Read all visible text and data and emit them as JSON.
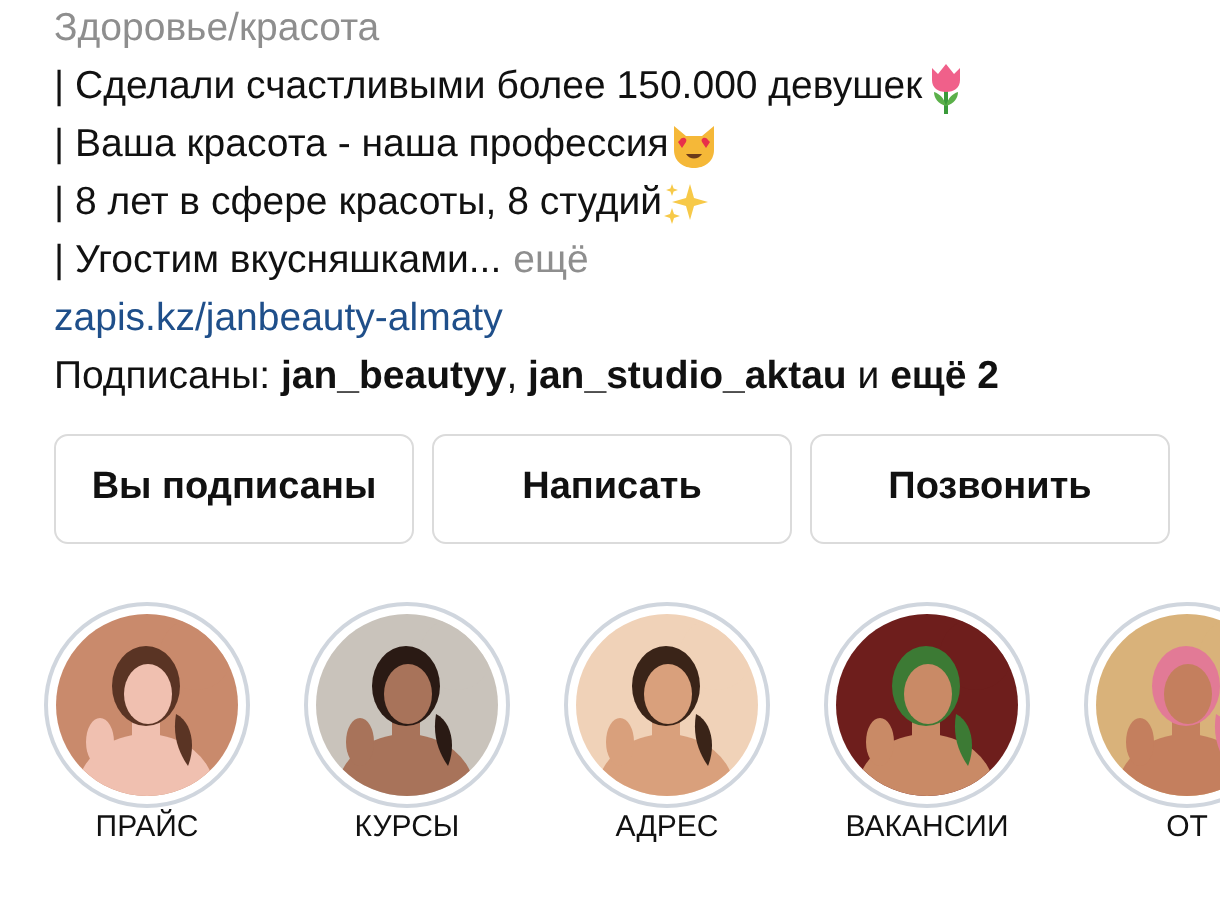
{
  "profile": {
    "category": "Здоровье/красота",
    "bio_lines": [
      {
        "text": "| Сделали счастливыми более 150.000 девушек",
        "kind": "tulip"
      },
      {
        "text": "| Ваша красота - наша профессия",
        "kind": "cat"
      },
      {
        "text": "| 8 лет в сфере красоты, 8 студий",
        "kind": "sparkles"
      },
      {
        "text": "| Угостим вкусняшками...",
        "more": "ещё",
        "kind": "plain"
      }
    ],
    "link": "zapis.kz/janbeauty-almaty",
    "followed_by": "Подписаны: **jan_beautyy**, **jan_studio_aktau** и **ещё 2**"
  },
  "buttons": [
    {
      "label": "Вы подписаны"
    },
    {
      "label": "Написать"
    },
    {
      "label": "Позвонить"
    }
  ],
  "highlights": [
    {
      "label": "ПРАЙС",
      "kind": "picture"
    },
    {
      "label": "КУРСЫ",
      "kind": "picture"
    },
    {
      "label": "АДРЕС",
      "kind": "picture"
    },
    {
      "label": "ВАКАНСИИ",
      "kind": "picture"
    },
    {
      "label": "ОТ",
      "kind": "picture"
    }
  ]
}
